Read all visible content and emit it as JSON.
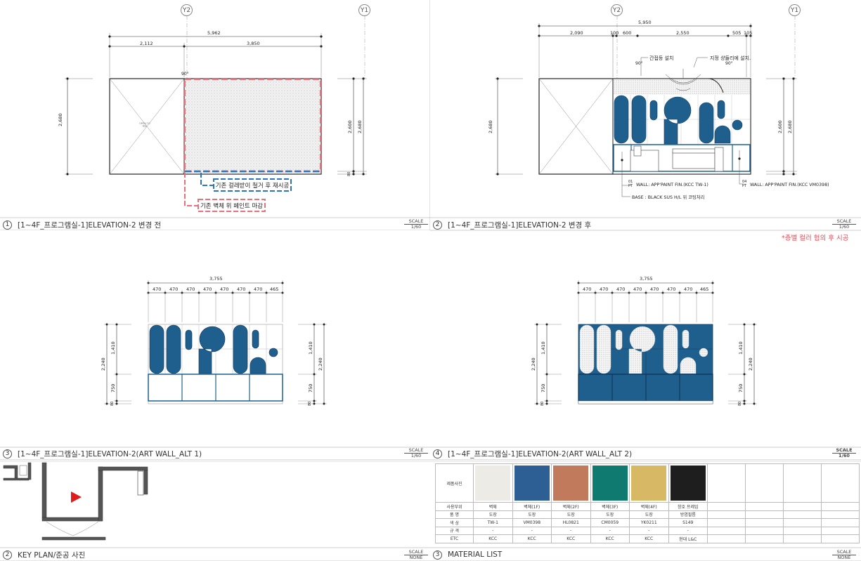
{
  "grid_axes": [
    "Y2",
    "Y1"
  ],
  "panel1": {
    "number": "1",
    "title": "[1~4F_프로그램실-1]ELEVATION-2 변경 전",
    "scale_label": "SCALE",
    "scale_value": "1/60",
    "dims_total": "5,962",
    "dims_parts": [
      "2,112",
      "3,850"
    ],
    "height_left": "2,680",
    "height_right_inner": "2,600",
    "height_right_outer": "2,680",
    "small_dim": "80",
    "angle": "90°",
    "open_to": "OPEN TO\n복도",
    "callout_blue": "기존 걸레받이 철거 후 재시공",
    "callout_red": "기존 벽체 위 페인트 마감"
  },
  "panel2": {
    "number": "2",
    "title": "[1~4F_프로그램실-1]ELEVATION-2 변경 후",
    "scale_label": "SCALE",
    "scale_value": "1/60",
    "dims_total": "5,950",
    "dims_parts": [
      "2,090",
      "100",
      "600",
      "2,550",
      "505",
      "105"
    ],
    "height_left": "2,680",
    "height_right_inner": "2,600",
    "height_right_outer": "2,680",
    "angle": "90°",
    "note_light": "간접등 설치",
    "note_chandelier": "지정 샹들리에 설치.",
    "note_wall1_tag": "01\nPT",
    "note_wall1": "WALL: APP'PAINT FIN.(KCC TW-1)",
    "note_base": "BASE : BLACK SUS H/L 위 코팅처리",
    "note_wall2_tag": "04\nPT",
    "note_wall2": "WALL: APP'PAINT FIN.(KCC VM0398)",
    "red_note": "*층별 컬러 협의 후 시공"
  },
  "panel3": {
    "number": "3",
    "title": "[1~4F_프로그램실-1]ELEVATION-2(ART WALL_ALT 1)",
    "scale_label": "SCALE",
    "scale_value": "1/60",
    "dims_total": "3,755",
    "dims_parts": [
      "470",
      "470",
      "470",
      "470",
      "470",
      "470",
      "470",
      "465"
    ],
    "h_total": "2,240",
    "h_upper": "1,410",
    "h_lower": "750",
    "h_base": "80"
  },
  "panel4": {
    "number": "4",
    "title": "[1~4F_프로그램실-1]ELEVATION-2(ART WALL_ALT 2)",
    "scale_label": "SCALE",
    "scale_value": "1/60",
    "dims_total": "3,755",
    "dims_parts": [
      "470",
      "470",
      "470",
      "470",
      "470",
      "470",
      "470",
      "465"
    ],
    "h_total": "2,240",
    "h_upper": "1,410",
    "h_lower": "750",
    "h_base": "80"
  },
  "panel5": {
    "number": "2",
    "title": "KEY PLAN/준공 사진",
    "scale_label": "SCALE",
    "scale_value": "NONE"
  },
  "panel6": {
    "number": "3",
    "title": "MATERIAL LIST",
    "scale_label": "SCALE",
    "scale_value": "NONE",
    "row_headers": [
      "제품사진",
      "사용부위",
      "품 명",
      "색 상",
      "규 격",
      "ETC"
    ],
    "materials": [
      {
        "swatch": "#ecebe6",
        "use": "벽체",
        "name": "도장",
        "color": "TW-1",
        "spec": "-",
        "etc": "KCC"
      },
      {
        "swatch": "#2e5f94",
        "use": "벽체(1F)",
        "name": "도장",
        "color": "VM0398",
        "spec": "-",
        "etc": "KCC"
      },
      {
        "swatch": "#c27a5c",
        "use": "벽체(2F)",
        "name": "도장",
        "color": "HL0821",
        "spec": "-",
        "etc": "KCC"
      },
      {
        "swatch": "#0f7a70",
        "use": "벽체(3F)",
        "name": "도장",
        "color": "CM0059",
        "spec": "-",
        "etc": "KCC"
      },
      {
        "swatch": "#d6b865",
        "use": "벽체(4F)",
        "name": "도장",
        "color": "YK0211",
        "spec": "-",
        "etc": "KCC"
      },
      {
        "swatch": "#1e1e1e",
        "use": "창호 프레임",
        "name": "방염필름",
        "color": "S149",
        "spec": "-",
        "etc": "현대 L&C"
      }
    ]
  },
  "colors": {
    "artwall_blue": "#1f5f8e",
    "red_dash": "#e8707a",
    "blue_dash": "#2e72b8",
    "arrow_red": "#e01b1b"
  }
}
